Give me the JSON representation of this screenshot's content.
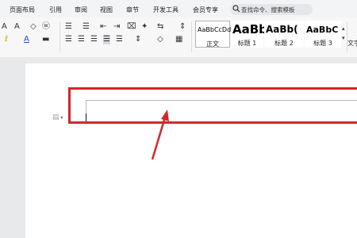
{
  "menu": {
    "items": [
      "页面布局",
      "引用",
      "审阅",
      "视图",
      "章节",
      "开发工具",
      "会员专享"
    ],
    "search_placeholder": "查找命令、搜索模板"
  },
  "ribbon": {
    "row1_glyphs": [
      "A",
      "A",
      "◇",
      "ⓦ",
      "☰",
      "☰",
      "⇤",
      "⇥",
      "⌧",
      "✦",
      "⇆"
    ],
    "row2_glyphs": [
      "ℓ",
      "A",
      "▬",
      "☰",
      "☰",
      "☰",
      "☰",
      "☰",
      "⇕",
      "◇",
      "▦"
    ],
    "row1b": "⇕",
    "row2b": "▦",
    "styles": [
      {
        "sample": "AaBbCcDd",
        "label": "正文"
      },
      {
        "sample": "AaBb",
        "label": "标题 1"
      },
      {
        "sample": "AaBb(",
        "label": "标题 2"
      },
      {
        "sample": "AaBbC",
        "label": "标题 3"
      }
    ],
    "right_label": "文字"
  },
  "document": {
    "paragraph_icon": "paragraph-handle-icon",
    "arrow_icon": "red-arrow-annotation",
    "accent_color": "#d4262c"
  }
}
